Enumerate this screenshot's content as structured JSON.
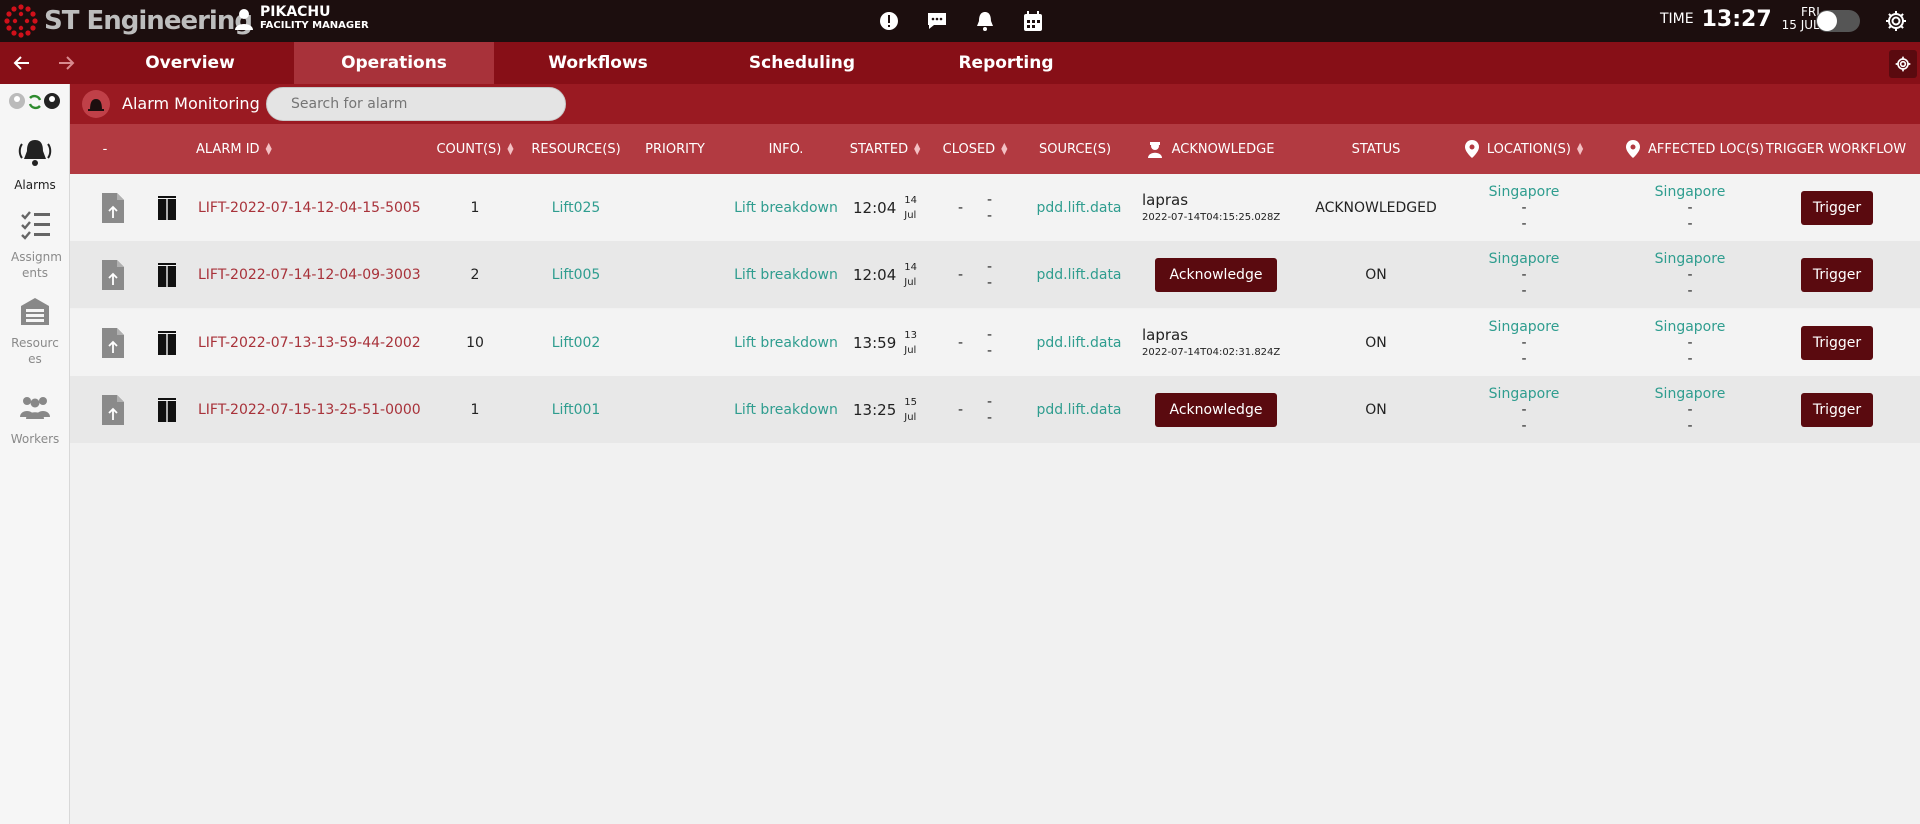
{
  "brand": {
    "name": "ST Engineering"
  },
  "user": {
    "name": "PIKACHU",
    "role": "FACILITY MANAGER"
  },
  "header": {
    "time_label": "TIME",
    "time": "13:27",
    "day": "FRI",
    "date": "15 JUL"
  },
  "nav": {
    "tabs": [
      {
        "label": "Overview"
      },
      {
        "label": "Operations"
      },
      {
        "label": "Workflows"
      },
      {
        "label": "Scheduling"
      },
      {
        "label": "Reporting"
      }
    ],
    "active": "Operations"
  },
  "sidebar": {
    "items": [
      {
        "label": "Alarms",
        "icon": "bell-icon"
      },
      {
        "label": "Assignm ents",
        "icon": "checklist-icon"
      },
      {
        "label": "Resourc es",
        "icon": "warehouse-icon"
      },
      {
        "label": "Workers",
        "icon": "group-icon"
      }
    ]
  },
  "alarm_panel": {
    "title": "Alarm Monitoring",
    "search_placeholder": "Search for alarm"
  },
  "table": {
    "columns": [
      "-",
      "ALARM ID",
      "COUNT(S)",
      "RESOURCE(S)",
      "PRIORITY",
      "INFO.",
      "STARTED",
      "CLOSED",
      "SOURCE(S)",
      "ACKNOWLEDGE",
      "STATUS",
      "LOCATION(S)",
      "AFFECTED LOC(S)",
      "TRIGGER WORKFLOW"
    ],
    "rows": [
      {
        "id": "LIFT-2022-07-14-12-04-15-5005",
        "count": "1",
        "resource": "Lift025",
        "info": "Lift breakdown",
        "start_time": "12:04",
        "start_day": "14",
        "start_month": "Jul",
        "closed_time": "-",
        "closed_a": "-",
        "closed_b": "-",
        "source": "pdd.lift.data",
        "ack_by": "lapras",
        "ack_time": "2022-07-14T04:15:25.028Z",
        "ack_button": "",
        "status": "ACKNOWLEDGED",
        "loc": "Singapore",
        "loc_a": "-",
        "loc_b": "-",
        "aloc": "Singapore",
        "aloc_a": "-",
        "aloc_b": "-",
        "trigger": "Trigger"
      },
      {
        "id": "LIFT-2022-07-14-12-04-09-3003",
        "count": "2",
        "resource": "Lift005",
        "info": "Lift breakdown",
        "start_time": "12:04",
        "start_day": "14",
        "start_month": "Jul",
        "closed_time": "-",
        "closed_a": "-",
        "closed_b": "-",
        "source": "pdd.lift.data",
        "ack_by": "",
        "ack_time": "",
        "ack_button": "Acknowledge",
        "status": "ON",
        "loc": "Singapore",
        "loc_a": "-",
        "loc_b": "-",
        "aloc": "Singapore",
        "aloc_a": "-",
        "aloc_b": "-",
        "trigger": "Trigger"
      },
      {
        "id": "LIFT-2022-07-13-13-59-44-2002",
        "count": "10",
        "resource": "Lift002",
        "info": "Lift breakdown",
        "start_time": "13:59",
        "start_day": "13",
        "start_month": "Jul",
        "closed_time": "-",
        "closed_a": "-",
        "closed_b": "-",
        "source": "pdd.lift.data",
        "ack_by": "lapras",
        "ack_time": "2022-07-14T04:02:31.824Z",
        "ack_button": "",
        "status": "ON",
        "loc": "Singapore",
        "loc_a": "-",
        "loc_b": "-",
        "aloc": "Singapore",
        "aloc_a": "-",
        "aloc_b": "-",
        "trigger": "Trigger"
      },
      {
        "id": "LIFT-2022-07-15-13-25-51-0000",
        "count": "1",
        "resource": "Lift001",
        "info": "Lift breakdown",
        "start_time": "13:25",
        "start_day": "15",
        "start_month": "Jul",
        "closed_time": "-",
        "closed_a": "-",
        "closed_b": "-",
        "source": "pdd.lift.data",
        "ack_by": "",
        "ack_time": "",
        "ack_button": "Acknowledge",
        "status": "ON",
        "loc": "Singapore",
        "loc_a": "-",
        "loc_b": "-",
        "aloc": "Singapore",
        "aloc_a": "-",
        "aloc_b": "-",
        "trigger": "Trigger"
      }
    ]
  },
  "colors": {
    "topbar": "#1c0e0e",
    "navbar": "#870f17",
    "active_tab": "#a8323a",
    "table_header": "#b23a41",
    "button": "#5a0a0f",
    "link_red": "#a8323a",
    "link_teal": "#2f9d8f"
  }
}
